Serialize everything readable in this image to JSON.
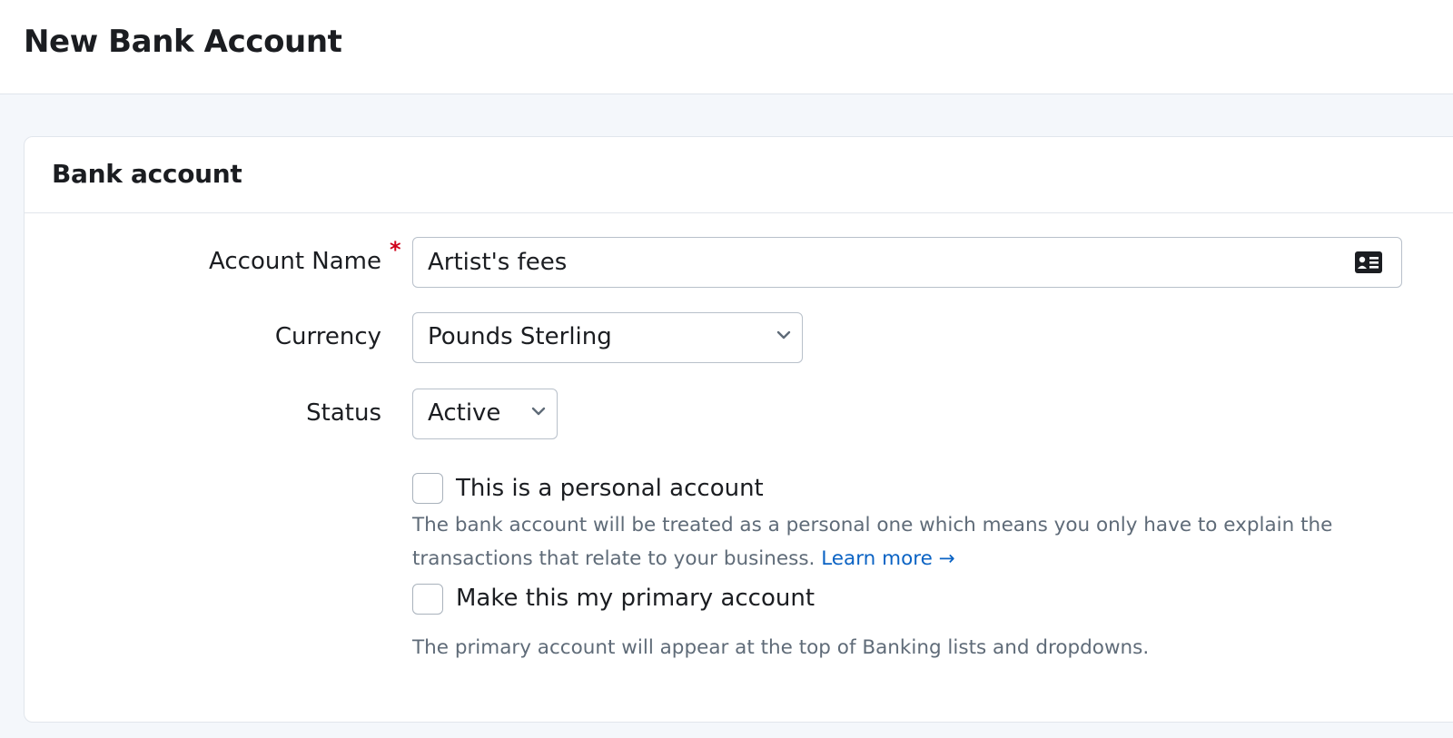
{
  "page": {
    "title": "New Bank Account"
  },
  "card": {
    "title": "Bank account"
  },
  "form": {
    "account_name": {
      "label": "Account Name",
      "required_mark": "*",
      "value": "Artist's fees",
      "icon": "contact-card-icon"
    },
    "currency": {
      "label": "Currency",
      "selected": "Pounds Sterling",
      "icon": "chevron-down-icon"
    },
    "status": {
      "label": "Status",
      "selected": "Active",
      "icon": "chevron-down-icon"
    },
    "personal": {
      "label": "This is a personal account",
      "checked": false,
      "help_line1": "The bank account will be treated as a personal one which means you only have to explain the",
      "help_line2": "transactions that relate to your business.",
      "learn_more": "Learn more →"
    },
    "primary": {
      "label": "Make this my primary account",
      "checked": false,
      "help": "The primary account will appear at the top of Banking lists and dropdowns."
    }
  },
  "colors": {
    "accent": "#0b63c4",
    "required": "#d0021b",
    "muted_text": "#5f6b78",
    "page_bg": "#f4f7fb"
  }
}
